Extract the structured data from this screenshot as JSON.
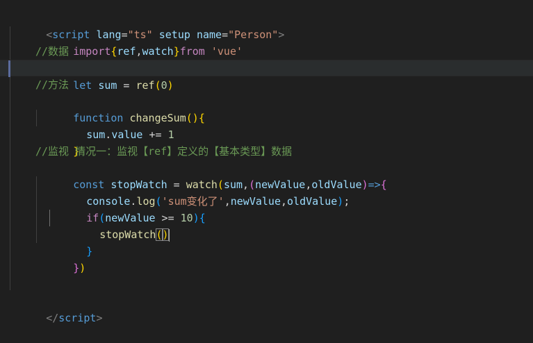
{
  "editor": {
    "lines": {
      "l1": {
        "open": "<",
        "tag": "script",
        "a1": "lang",
        "eq1": "=",
        "v1": "\"ts\"",
        "a2": "setup",
        "a3": "name",
        "eq3": "=",
        "v3": "\"Person\"",
        "close": ">"
      },
      "l2": {
        "kw": "import",
        "lb": "{",
        "v1": "ref",
        "comma": ",",
        "v2": "watch",
        "rb": "}",
        "kw2": "from",
        "sp": " ",
        "str": "'vue'"
      },
      "l3": {
        "cmt": "//数据"
      },
      "l4": {
        "kw": "let",
        "var": "sum",
        "eq": " = ",
        "fn": "ref",
        "lp": "(",
        "num": "0",
        "rp": ")"
      },
      "l5": {
        "cmt": "//方法"
      },
      "l6": {
        "kw": "function",
        "fn": "changeSum",
        "lp": "(",
        "rp": ")",
        "lb": "{"
      },
      "l7": {
        "v1": "sum",
        "dot": ".",
        "v2": "value",
        "op": " += ",
        "num": "1"
      },
      "l8": {
        "rb": "}"
      },
      "l9": {
        "cmt": "//监视 情况一：监视【ref】定义的【基本类型】数据"
      },
      "l10": {
        "kw": "const",
        "var": "stopWatch",
        "eq": " = ",
        "fn": "watch",
        "lp": "(",
        "a1": "sum",
        "c1": ",",
        "lp2": "(",
        "a2": "newValue",
        "c2": ",",
        "a3": "oldValue",
        "rp2": ")",
        "arrow": "=>",
        "lb": "{"
      },
      "l11": {
        "v1": "console",
        "dot": ".",
        "fn": "log",
        "lp": "(",
        "str": "'sum变化了'",
        "c1": ",",
        "a1": "newValue",
        "c2": ",",
        "a2": "oldValue",
        "rp": ")",
        "semi": ";"
      },
      "l12": {
        "kw": "if",
        "lp": "(",
        "var": "newValue",
        "op": " >= ",
        "num": "10",
        "rp": ")",
        "lb": "{"
      },
      "l13": {
        "fn": "stopWatch",
        "lp": "(",
        "rp": ")"
      },
      "l14": {
        "rb": "}"
      },
      "l15": {
        "rp": "}",
        "rb": ")"
      },
      "l18": {
        "open": "</",
        "tag": "script",
        "close": ">"
      }
    }
  }
}
